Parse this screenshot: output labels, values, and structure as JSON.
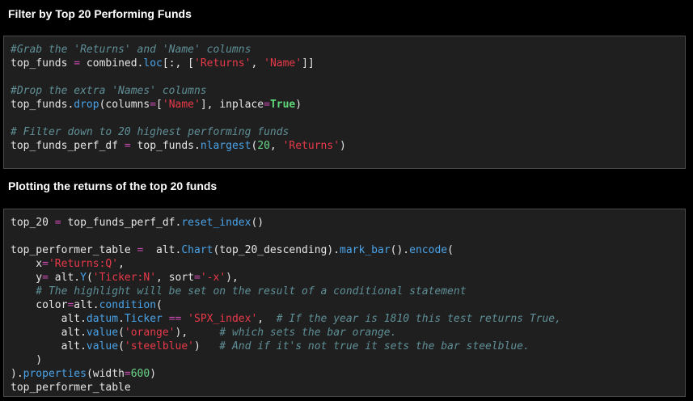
{
  "sections": [
    {
      "heading": "Filter by Top 20 Performing Funds"
    },
    {
      "heading": "Plotting the returns of the top 20 funds"
    }
  ],
  "cell1": [
    [
      [
        "c",
        "#Grab the 'Returns' and 'Name' columns"
      ]
    ],
    [
      [
        "t",
        "top_funds "
      ],
      [
        "o",
        "="
      ],
      [
        "t",
        " combined."
      ],
      [
        "f",
        "loc"
      ],
      [
        "t",
        "[:, ["
      ],
      [
        "s",
        "'Returns'"
      ],
      [
        "t",
        ", "
      ],
      [
        "s",
        "'Name'"
      ],
      [
        "t",
        "]]"
      ]
    ],
    [
      [
        "t",
        ""
      ]
    ],
    [
      [
        "c",
        "#Drop the extra 'Names' columns"
      ]
    ],
    [
      [
        "t",
        "top_funds."
      ],
      [
        "f",
        "drop"
      ],
      [
        "t",
        "(columns"
      ],
      [
        "o",
        "="
      ],
      [
        "t",
        "["
      ],
      [
        "s",
        "'Name'"
      ],
      [
        "t",
        "], inplace"
      ],
      [
        "o",
        "="
      ],
      [
        "k",
        "True"
      ],
      [
        "t",
        ")"
      ]
    ],
    [
      [
        "t",
        ""
      ]
    ],
    [
      [
        "c",
        "# Filter down to 20 highest performing funds"
      ]
    ],
    [
      [
        "t",
        "top_funds_perf_df "
      ],
      [
        "o",
        "="
      ],
      [
        "t",
        " top_funds."
      ],
      [
        "f",
        "nlargest"
      ],
      [
        "t",
        "("
      ],
      [
        "n",
        "20"
      ],
      [
        "t",
        ", "
      ],
      [
        "s",
        "'Returns'"
      ],
      [
        "t",
        ")"
      ]
    ]
  ],
  "cell2": [
    [
      [
        "t",
        "top_20 "
      ],
      [
        "o",
        "="
      ],
      [
        "t",
        " top_funds_perf_df."
      ],
      [
        "f",
        "reset_index"
      ],
      [
        "t",
        "()"
      ]
    ],
    [
      [
        "t",
        ""
      ]
    ],
    [
      [
        "t",
        "top_performer_table "
      ],
      [
        "o",
        "="
      ],
      [
        "t",
        "  alt."
      ],
      [
        "f",
        "Chart"
      ],
      [
        "t",
        "(top_20_descending)."
      ],
      [
        "f",
        "mark_bar"
      ],
      [
        "t",
        "()."
      ],
      [
        "f",
        "encode"
      ],
      [
        "t",
        "("
      ]
    ],
    [
      [
        "t",
        "    x"
      ],
      [
        "o",
        "="
      ],
      [
        "s",
        "'Returns:Q'"
      ],
      [
        "t",
        ","
      ]
    ],
    [
      [
        "t",
        "    y"
      ],
      [
        "o",
        "="
      ],
      [
        "t",
        " alt."
      ],
      [
        "f",
        "Y"
      ],
      [
        "t",
        "("
      ],
      [
        "s",
        "'Ticker:N'"
      ],
      [
        "t",
        ", sort"
      ],
      [
        "o",
        "="
      ],
      [
        "s",
        "'-x'"
      ],
      [
        "t",
        "),"
      ]
    ],
    [
      [
        "c",
        "    # The highlight will be set on the result of a conditional statement"
      ]
    ],
    [
      [
        "t",
        "    color"
      ],
      [
        "o",
        "="
      ],
      [
        "t",
        "alt."
      ],
      [
        "f",
        "condition"
      ],
      [
        "t",
        "("
      ]
    ],
    [
      [
        "t",
        "        alt."
      ],
      [
        "f",
        "datum"
      ],
      [
        "t",
        "."
      ],
      [
        "f",
        "Ticker"
      ],
      [
        "t",
        " "
      ],
      [
        "o",
        "=="
      ],
      [
        "t",
        " "
      ],
      [
        "s",
        "'SPX_index'"
      ],
      [
        "t",
        ",  "
      ],
      [
        "c",
        "# If the year is 1810 this test returns True,"
      ]
    ],
    [
      [
        "t",
        "        alt."
      ],
      [
        "f",
        "value"
      ],
      [
        "t",
        "("
      ],
      [
        "s",
        "'orange'"
      ],
      [
        "t",
        "),     "
      ],
      [
        "c",
        "# which sets the bar orange."
      ]
    ],
    [
      [
        "t",
        "        alt."
      ],
      [
        "f",
        "value"
      ],
      [
        "t",
        "("
      ],
      [
        "s",
        "'steelblue'"
      ],
      [
        "t",
        ")   "
      ],
      [
        "c",
        "# And if it's not true it sets the bar steelblue."
      ]
    ],
    [
      [
        "t",
        "    )"
      ]
    ],
    [
      [
        "t",
        ")."
      ],
      [
        "f",
        "properties"
      ],
      [
        "t",
        "(width"
      ],
      [
        "o",
        "="
      ],
      [
        "n",
        "600"
      ],
      [
        "t",
        ")"
      ]
    ],
    [
      [
        "t",
        "top_performer_table"
      ]
    ]
  ]
}
